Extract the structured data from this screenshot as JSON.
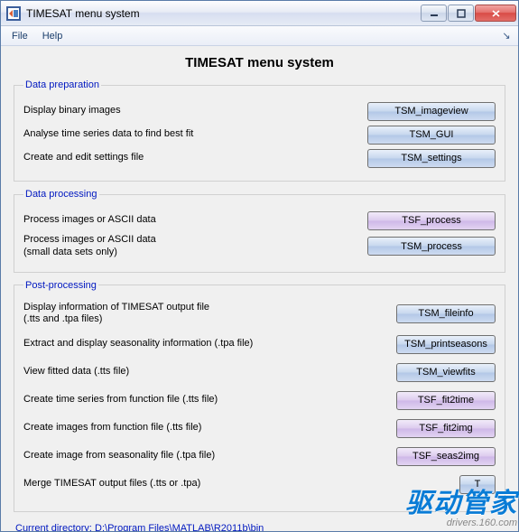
{
  "window": {
    "title": "TIMESAT menu system"
  },
  "menubar": {
    "file": "File",
    "help": "Help"
  },
  "main_title": "TIMESAT menu system",
  "groups": {
    "prep": {
      "legend": "Data preparation",
      "rows": [
        {
          "label": "Display binary images",
          "btn": "TSM_imageview",
          "color": "blue"
        },
        {
          "label": "Analyse time series data to find best fit",
          "btn": "TSM_GUI",
          "color": "blue"
        },
        {
          "label": "Create and edit settings file",
          "btn": "TSM_settings",
          "color": "blue"
        }
      ]
    },
    "proc": {
      "legend": "Data processing",
      "rows": [
        {
          "label": "Process images or ASCII data",
          "btn": "TSF_process",
          "color": "purple"
        },
        {
          "label": "Process images or ASCII data",
          "sub": "(small data sets only)",
          "btn": "TSM_process",
          "color": "blue"
        }
      ]
    },
    "post": {
      "legend": "Post-processing",
      "rows": [
        {
          "label": "Display information of TIMESAT output file",
          "sub": "(.tts and .tpa files)",
          "btn": "TSM_fileinfo",
          "color": "blue"
        },
        {
          "label": "Extract and display seasonality information (.tpa file)",
          "btn": "TSM_printseasons",
          "color": "blue"
        },
        {
          "label": "View fitted data (.tts file)",
          "btn": "TSM_viewfits",
          "color": "blue"
        },
        {
          "label": "Create time series from function file (.tts file)",
          "btn": "TSF_fit2time",
          "color": "purple"
        },
        {
          "label": "Create images from function file (.tts file)",
          "btn": "TSF_fit2img",
          "color": "purple"
        },
        {
          "label": "Create image from seasonality file (.tpa file)",
          "btn": "TSF_seas2img",
          "color": "purple"
        },
        {
          "label": "Merge TIMESAT output files (.tts or .tpa)",
          "btn": "T",
          "color": "blue"
        }
      ]
    }
  },
  "current_dir_label": "Current directory:  D:\\Program Files\\MATLAB\\R2011b\\bin",
  "watermark": {
    "cn": "驱动管家",
    "url": "drivers.160.com"
  }
}
